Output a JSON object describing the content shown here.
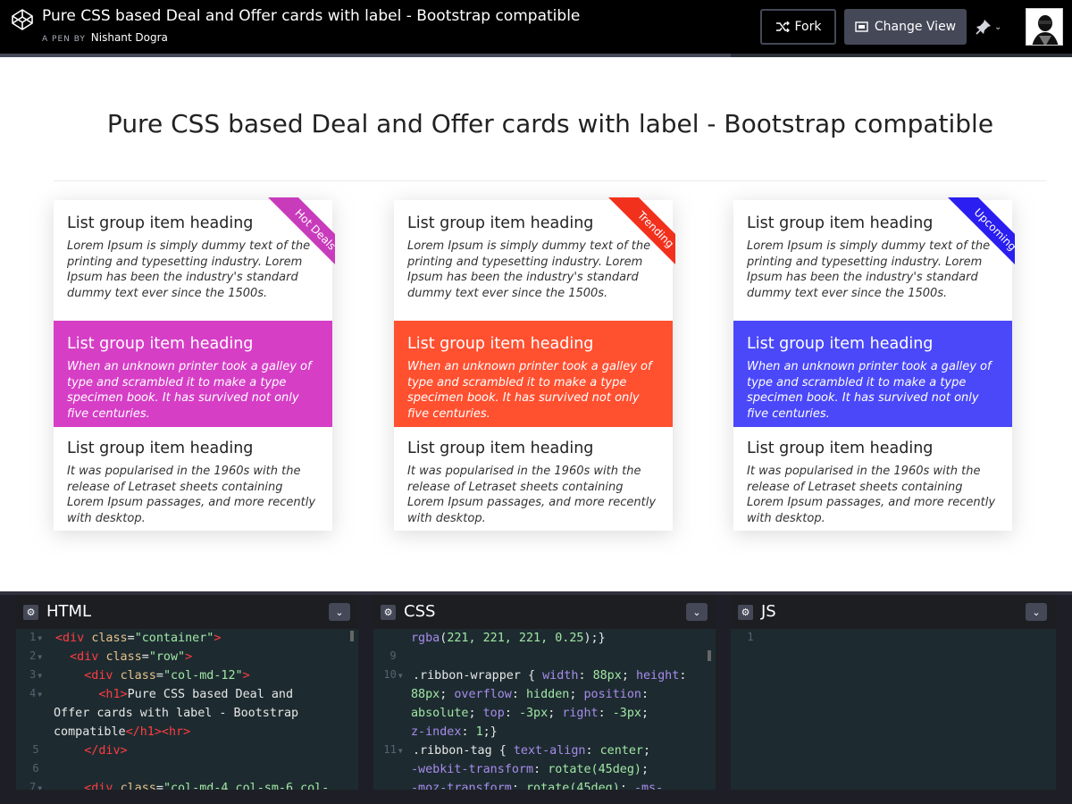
{
  "header": {
    "title": "Pure CSS based Deal and Offer cards with label - Bootstrap compatible",
    "byline_prefix": "A PEN BY",
    "author": "Nishant Dogra",
    "fork_label": "Fork",
    "change_view_label": "Change View"
  },
  "preview": {
    "heading": "Pure CSS based Deal and Offer cards with label - Bootstrap compatible",
    "cards": [
      {
        "ribbon": "Hot Deals",
        "accent": "#d63ec6",
        "items": [
          {
            "heading": "List group item heading",
            "text": "Lorem Ipsum is simply dummy text of the printing and typesetting industry. Lorem Ipsum has been the industry's standard dummy text ever since the 1500s."
          },
          {
            "heading": "List group item heading",
            "text": "When an unknown printer took a galley of type and scrambled it to make a type specimen book. It has survived not only five centuries."
          },
          {
            "heading": "List group item heading",
            "text": "It was popularised in the 1960s with the release of Letraset sheets containing Lorem Ipsum passages, and more recently with desktop."
          }
        ]
      },
      {
        "ribbon": "Trending",
        "accent": "#ff5030",
        "items": [
          {
            "heading": "List group item heading",
            "text": "Lorem Ipsum is simply dummy text of the printing and typesetting industry. Lorem Ipsum has been the industry's standard dummy text ever since the 1500s."
          },
          {
            "heading": "List group item heading",
            "text": "When an unknown printer took a galley of type and scrambled it to make a type specimen book. It has survived not only five centuries."
          },
          {
            "heading": "List group item heading",
            "text": "It was popularised in the 1960s with the release of Letraset sheets containing Lorem Ipsum passages, and more recently with desktop."
          }
        ]
      },
      {
        "ribbon": "Upcoming",
        "accent": "#4a48f8",
        "items": [
          {
            "heading": "List group item heading",
            "text": "Lorem Ipsum is simply dummy text of the printing and typesetting industry. Lorem Ipsum has been the industry's standard dummy text ever since the 1500s."
          },
          {
            "heading": "List group item heading",
            "text": "When an unknown printer took a galley of type and scrambled it to make a type specimen book. It has survived not only five centuries."
          },
          {
            "heading": "List group item heading",
            "text": "It was popularised in the 1960s with the release of Letraset sheets containing Lorem Ipsum passages, and more recently with desktop."
          }
        ]
      }
    ]
  },
  "editors": {
    "html": {
      "title": "HTML",
      "lines": [
        {
          "num": "1",
          "fold": true,
          "code": "<div class=\"container\">"
        },
        {
          "num": "2",
          "fold": true,
          "code": "  <div class=\"row\">"
        },
        {
          "num": "3",
          "fold": true,
          "code": "    <div class=\"col-md-12\">"
        },
        {
          "num": "4",
          "fold": true,
          "code": "      <h1>Pure CSS based Deal and"
        },
        {
          "num": "",
          "fold": false,
          "code": "Offer cards with label - Bootstrap"
        },
        {
          "num": "",
          "fold": false,
          "code": "compatible</h1><hr>"
        },
        {
          "num": "5",
          "fold": false,
          "code": "    </div>"
        },
        {
          "num": "6",
          "fold": false,
          "code": ""
        },
        {
          "num": "7",
          "fold": true,
          "code": "    <div class=\"col-md-4 col-sm-6 col-"
        }
      ]
    },
    "css": {
      "title": "CSS",
      "lines": [
        {
          "num": "",
          "fold": false,
          "code": "rgba(221, 221, 221, 0.25);}"
        },
        {
          "num": "9",
          "fold": false,
          "code": ""
        },
        {
          "num": "10",
          "fold": true,
          "code": ".ribbon-wrapper { width: 88px; height:"
        },
        {
          "num": "",
          "fold": false,
          "code": "88px; overflow: hidden; position:"
        },
        {
          "num": "",
          "fold": false,
          "code": "absolute; top: -3px; right: -3px;"
        },
        {
          "num": "",
          "fold": false,
          "code": "z-index: 1;}"
        },
        {
          "num": "11",
          "fold": true,
          "code": ".ribbon-tag { text-align: center;"
        },
        {
          "num": "",
          "fold": false,
          "code": "-webkit-transform: rotate(45deg);"
        },
        {
          "num": "",
          "fold": false,
          "code": "-moz-transform: rotate(45deg); -ms-"
        }
      ]
    },
    "js": {
      "title": "JS",
      "lines": [
        {
          "num": "1",
          "fold": false,
          "code": ""
        }
      ]
    }
  }
}
